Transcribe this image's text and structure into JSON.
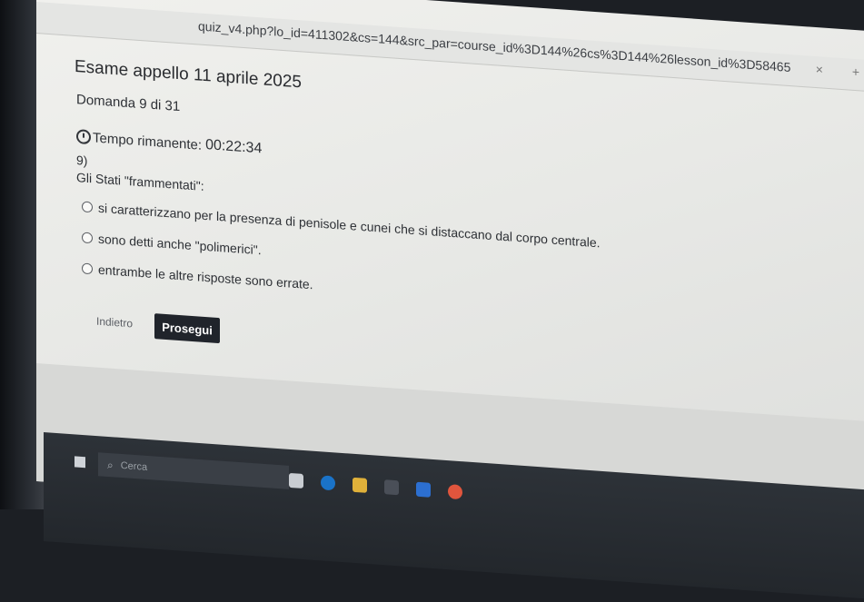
{
  "browser": {
    "url": "quiz_v4.php?lo_id=411302&cs=144&src_par=course_id%3D144%26cs%3D144%26lesson_id%3D58465"
  },
  "exam": {
    "title": "Esame appello 11 aprile 2025",
    "question_counter": "Domanda 9 di 31",
    "timer_label": "Tempo rimanente:",
    "timer_value": "00:22:34",
    "question_number": "9)",
    "question_text": "Gli Stati \"frammentati\":",
    "options": [
      "si caratterizzano per la presenza di penisole e cunei che si distaccano dal corpo centrale.",
      "sono detti anche \"polimerici\".",
      "entrambe le altre risposte sono errate."
    ],
    "back_label": "Indietro",
    "next_label": "Prosegui"
  },
  "taskbar": {
    "search_placeholder": "Cerca"
  },
  "colors": {
    "primary_button": "#20242b",
    "page_background": "#eeeeeb",
    "taskbar": "#2a2e34"
  },
  "icons": [
    "clock-icon",
    "radio-icon",
    "search-icon",
    "windows-start-icon"
  ]
}
